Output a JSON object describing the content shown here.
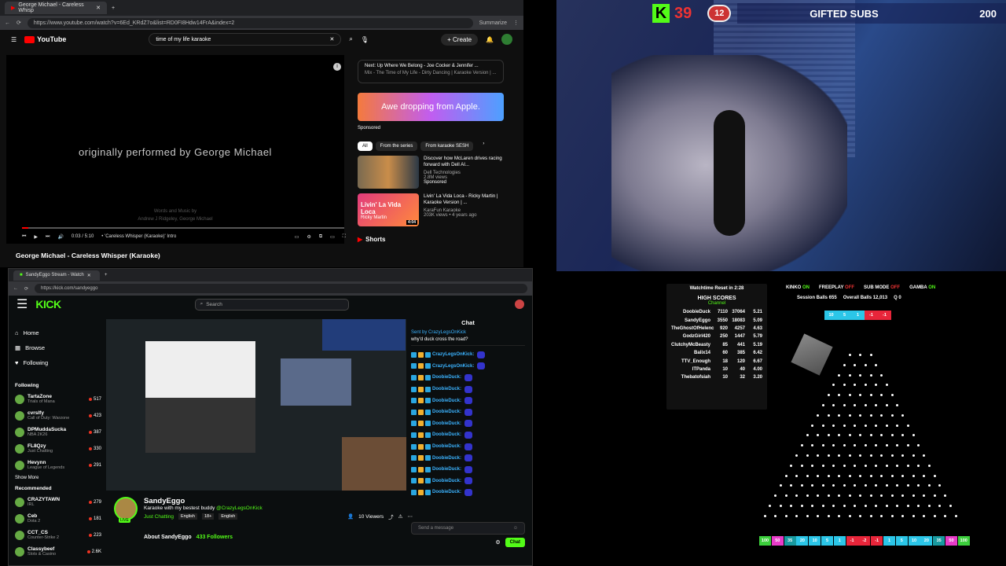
{
  "youtube": {
    "tab_title": "George Michael - Careless Whisp",
    "url": "https://www.youtube.com/watch?v=6Ed_KRdZ7o&list=RD0FI8Hdw14FrA&index=2",
    "summarize": "Summarize",
    "logo": "YouTube",
    "search_value": "time of my life karaoke",
    "create": "+ Create",
    "overlay": "originally performed by George Michael",
    "credits": "Words and Music by",
    "credits2": "Andrew J Ridgeley, George Michael",
    "time": "0:03 / 5:10",
    "chapter": "• 'Careless Whisper (Karaoke)' Intro",
    "video_title": "George Michael - Careless Whisper (Karaoke)",
    "next_label": "Next: Up Where We Belong - Joe Cocker & Jennifer ...",
    "next_sub": "Mix - The Time of My Life - Dirty Dancing | Karaoke Version | ...",
    "ad_text": "Awe dropping from Apple.",
    "sponsored": "Sponsored",
    "chips": [
      "All",
      "From the series",
      "From karaoke SESH"
    ],
    "recs": [
      {
        "title": "Discover how McLaren drives racing forward with Dell AI...",
        "channel": "Dell Technologies",
        "views": "2.8M views",
        "meta": "Sponsored"
      },
      {
        "title": "Livin' La Vida Loca - Ricky Martin | Karaoke Version | ...",
        "channel": "KaraFun Karaoke",
        "views": "203K views • 4 years ago",
        "meta": "",
        "thumb_text": "Livin' La Vida Loca",
        "thumb_sub": "Ricky Martin",
        "duration": "4:04"
      }
    ],
    "shorts": "Shorts"
  },
  "kick": {
    "tab_title": "SandyEggo Stream - Watch",
    "url": "https://kick.com/sandyeggo",
    "logo": "KICK",
    "search_placeholder": "Search",
    "nav": [
      "Home",
      "Browse",
      "Following"
    ],
    "following_label": "Following",
    "following": [
      {
        "name": "TartaZone",
        "game": "Trials of Mana",
        "count": "517"
      },
      {
        "name": "cvrslfy",
        "game": "Call of Duty: Warzone",
        "count": "423"
      },
      {
        "name": "DPMuddaSucka",
        "game": "NBA 2K26",
        "count": "387"
      },
      {
        "name": "FL8Qzy",
        "game": "Just Chatting",
        "count": "330"
      },
      {
        "name": "Hevynn",
        "game": "League of Legends",
        "count": "291"
      }
    ],
    "show_more": "Show More",
    "recommended_label": "Recommended",
    "recommended": [
      {
        "name": "CRAZYTAWN",
        "game": "IRL",
        "count": "279"
      },
      {
        "name": "Ceb",
        "game": "Dota 2",
        "count": "181"
      },
      {
        "name": "CCT_CS",
        "game": "Counter-Strike 2",
        "count": "223"
      },
      {
        "name": "Classybeef",
        "game": "Slots & Casino",
        "count": "2.6K"
      }
    ],
    "streamer": "SandyEggo",
    "live": "LIVE",
    "stream_title": "Karaoke with my  bestest buddy",
    "mention": "@CrazyLegsOnKick",
    "category": "Just Chatting",
    "tags": [
      "English",
      "18+",
      "English"
    ],
    "viewers": "10 Viewers",
    "about": "About SandyEggo",
    "followers": "433 Followers",
    "chat_title": "Chat",
    "pinned_by": "Sent by CrazyLegsOnKick",
    "pinned_msg": "why'd duck cross the road?",
    "chat_users": [
      "CrazyLegsOnKick:",
      "CrazyLegsOnKick:",
      "DoobieDuck:",
      "DoobieDuck:",
      "DoobieDuck:",
      "DoobieDuck:",
      "DoobieDuck:",
      "DoobieDuck:",
      "DoobieDuck:",
      "DoobieDuck:",
      "DoobieDuck:",
      "DoobieDuck:",
      "DoobieDuck:"
    ],
    "send_placeholder": "Send a message",
    "chat_button": "Chat"
  },
  "overlay": {
    "kick_count": "39",
    "bubble": "12",
    "gifted_label": "GIFTED SUBS",
    "gifted_value": "200"
  },
  "plinko": {
    "watchtime": "Watchtime Reset in 2:28",
    "high_scores": "HIGH SCORES",
    "channel": "Channel",
    "scores": [
      [
        "DoobieDuck",
        "7110",
        "37064",
        "5.21"
      ],
      [
        "SandyEggo",
        "3550",
        "18083",
        "5.09"
      ],
      [
        "TheGhostOfHelenc",
        "920",
        "4257",
        "4.63"
      ],
      [
        "GodzGirl420",
        "250",
        "1447",
        "5.79"
      ],
      [
        "ClutchyMcBeasty",
        "85",
        "441",
        "5.19"
      ],
      [
        "Balix14",
        "60",
        "385",
        "6.42"
      ],
      [
        "TTV_Enough",
        "18",
        "120",
        "6.67"
      ],
      [
        "ITPanda",
        "10",
        "40",
        "4.00"
      ],
      [
        "Thebatofsiah",
        "10",
        "32",
        "3.20"
      ]
    ],
    "flags": [
      {
        "label": "KINKO",
        "state": "ON"
      },
      {
        "label": "FREEPLAY",
        "state": "OFF"
      },
      {
        "label": "SUB MODE",
        "state": "OFF"
      },
      {
        "label": "GAMBA",
        "state": "ON"
      }
    ],
    "session_balls": "Session Balls  655",
    "overall_balls": "Overall Balls  12,013",
    "q": "Q  0",
    "top_slots": [
      "10",
      "5",
      "1",
      "-1",
      "-1"
    ],
    "bottom_slots": [
      "100",
      "50",
      "35",
      "20",
      "10",
      "5",
      "1",
      "-1",
      "-2",
      "-1",
      "1",
      "5",
      "10",
      "20",
      "35",
      "50",
      "100"
    ],
    "colors": {
      "cyan": "#2bc6e8",
      "red": "#e8253a",
      "green": "#3ccf3c",
      "pink": "#e83cc8",
      "teal": "#189aa0"
    }
  }
}
